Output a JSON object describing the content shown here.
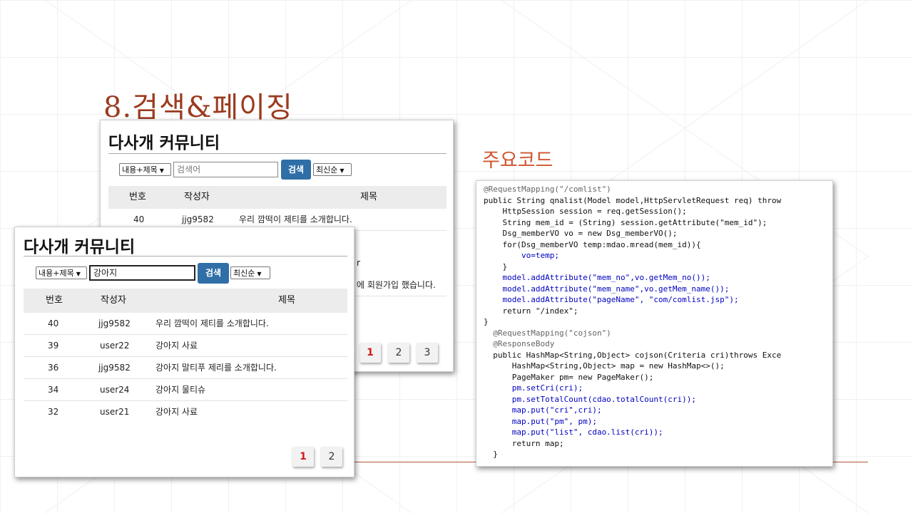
{
  "slide": {
    "title": "8.검색&페이징",
    "subtitle": "주요코드"
  },
  "back_screenshot": {
    "board_title": "다사개 커뮤니티",
    "search_type": "내용+제목",
    "search_input_placeholder": "검색어",
    "search_button": "검색",
    "sort": "최신순",
    "columns": [
      "번호",
      "작성자",
      "제목"
    ],
    "rows": [
      {
        "no": "40",
        "writer": "jjg9582",
        "title": "우리 깜떡이 제티를 소개합니다."
      }
    ],
    "partial_text_1": "r",
    "partial_text_2": "에 회원가입 했습니다.",
    "pages": [
      "1",
      "2",
      "3"
    ],
    "active_page": "1"
  },
  "front_screenshot": {
    "board_title": "다사개 커뮤니티",
    "search_type": "내용+제목",
    "search_input_value": "강아지",
    "search_button": "검색",
    "sort": "최신순",
    "columns": [
      "번호",
      "작성자",
      "제목"
    ],
    "rows": [
      {
        "no": "40",
        "writer": "jjg9582",
        "title": "우리 깜떡이 제티를 소개합니다."
      },
      {
        "no": "39",
        "writer": "user22",
        "title": "강아지 사료"
      },
      {
        "no": "36",
        "writer": "jjg9582",
        "title": "강아지 말티푸 제리를 소개합니다."
      },
      {
        "no": "34",
        "writer": "user24",
        "title": "강아지 물티슈"
      },
      {
        "no": "32",
        "writer": "user21",
        "title": "강아지 사료"
      }
    ],
    "pages": [
      "1",
      "2"
    ],
    "active_page": "1"
  },
  "code_lines": [
    "@RequestMapping(\"/comlist\")",
    "public String qnalist(Model model,HttpServletRequest req) throw",
    "    HttpSession session = req.getSession();",
    "    String mem_id = (String) session.getAttribute(\"mem_id\");",
    "    Dsg_memberVO vo = new Dsg_memberVO();",
    "    for(Dsg_memberVO temp:mdao.mread(mem_id)){",
    "        vo=temp;",
    "    }",
    "    model.addAttribute(\"mem_no\",vo.getMem_no());",
    "    model.addAttribute(\"mem_name\",vo.getMem_name());",
    "    model.addAttribute(\"pageName\", \"com/comlist.jsp\");",
    "    return \"/index\";",
    "}",
    "  @RequestMapping(\"cojson\")",
    "  @ResponseBody",
    "  public HashMap<String,Object> cojson(Criteria cri)throws Exce",
    "      HashMap<String,Object> map = new HashMap<>();",
    "      PageMaker pm= new PageMaker();",
    "      pm.setCri(cri);",
    "      pm.setTotalCount(cdao.totalCount(cri));",
    "      map.put(\"cri\",cri);",
    "      map.put(\"pm\", pm);",
    "      map.put(\"list\", cdao.list(cri));",
    "      return map;",
    "  }"
  ]
}
